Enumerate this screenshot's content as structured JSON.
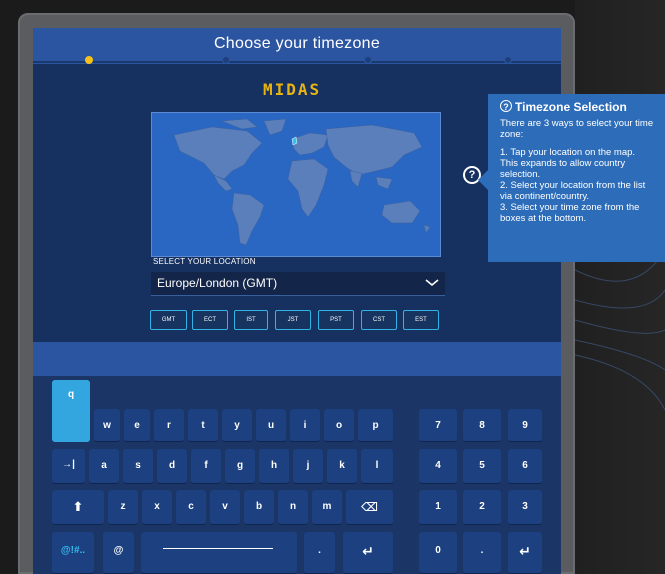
{
  "header": {
    "title": "Choose your timezone",
    "active_step": 1,
    "steps": 4
  },
  "brand": {
    "logo_text": "MIDAS",
    "logo_color": "#e6b413"
  },
  "location": {
    "label": "SELECT YOUR LOCATION",
    "selected": "Europe/London (GMT)",
    "highlight_region": "United Kingdom"
  },
  "timezones": [
    "GMT",
    "ECT",
    "IST",
    "JST",
    "PST",
    "CST",
    "EST"
  ],
  "help": {
    "icon": "question-circle-icon",
    "title": "Timezone Selection",
    "intro": "There are 3 ways to select your time zone:",
    "lines": [
      "1. Tap your location on the map. This expands to allow country selection.",
      "2. Select your location from the list via continent/country.",
      "3. Select your time zone from the boxes at the bottom."
    ]
  },
  "keyboard": {
    "row1": [
      "q",
      "w",
      "e",
      "r",
      "t",
      "y",
      "u",
      "i",
      "o",
      "p"
    ],
    "row2": [
      "→|",
      "a",
      "s",
      "d",
      "f",
      "g",
      "h",
      "j",
      "k",
      "l"
    ],
    "row3": [
      "⬆",
      "z",
      "x",
      "c",
      "v",
      "b",
      "n",
      "m",
      "⌫"
    ],
    "row4": [
      "@!#..",
      "@",
      "",
      ".",
      "↵"
    ],
    "numpad": [
      "7",
      "8",
      "9",
      "4",
      "5",
      "6",
      "1",
      "2",
      "3",
      "0",
      ".",
      "↵"
    ],
    "pressed_key": "q"
  },
  "colors": {
    "accent": "#33b3e5",
    "panel": "#2c55a1",
    "background": "#16305f",
    "active_step": "#f6c218"
  }
}
